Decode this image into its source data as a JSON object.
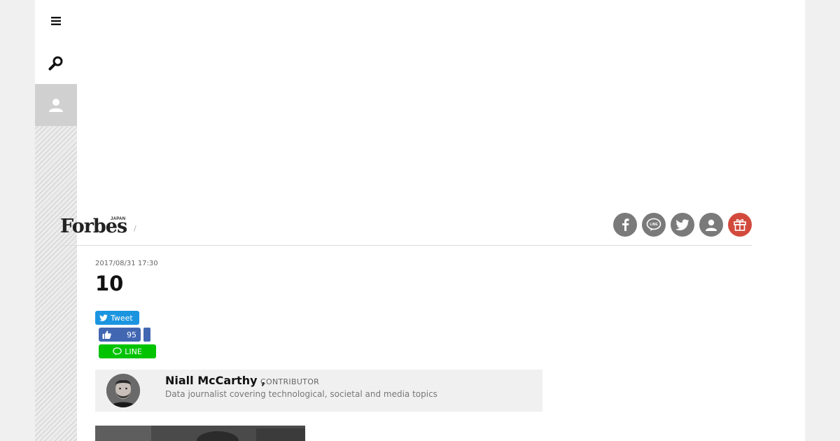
{
  "sidebar": {
    "menu_icon": "menu-icon",
    "search_icon": "search-icon",
    "user_icon": "user-icon"
  },
  "brand": {
    "logo": "Forbes",
    "logo_sub": "JAPAN",
    "separator": "/"
  },
  "social": [
    {
      "name": "facebook",
      "glyph": "f"
    },
    {
      "name": "line",
      "glyph": "LINE"
    },
    {
      "name": "twitter",
      "glyph": "twitter"
    },
    {
      "name": "account",
      "glyph": "user"
    },
    {
      "name": "gift",
      "glyph": "gift"
    }
  ],
  "colors": {
    "social_gray": "#7a7a7a",
    "gift_red": "#d24a3c",
    "twitter_blue": "#1b95e0",
    "facebook_blue": "#4267b2",
    "line_green": "#00c300"
  },
  "article": {
    "date": "2017/08/31 17:30",
    "title": "10"
  },
  "share": {
    "tweet_label": "Tweet",
    "like_count": "95",
    "line_label": "LINE"
  },
  "author": {
    "name": "Niall McCarthy ,",
    "role": "CONTRIBUTOR",
    "description": "Data journalist covering technological, societal and media topics"
  }
}
